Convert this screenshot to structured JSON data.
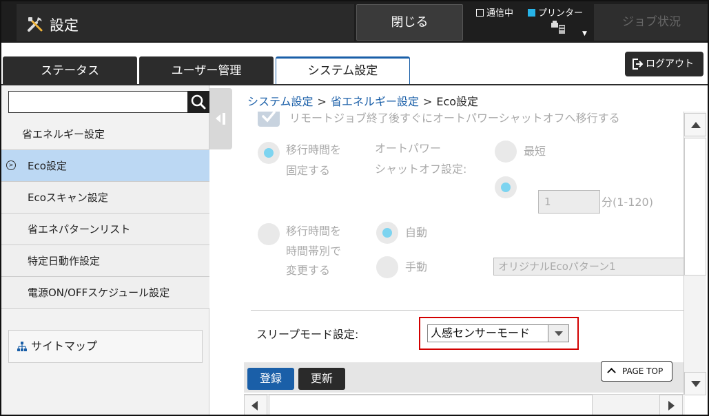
{
  "header": {
    "title": "設定",
    "title_icon": "tools-icon",
    "close_label": "閉じる",
    "indicators": [
      {
        "label": "通信中",
        "state": "off",
        "color": "#ffffff"
      },
      {
        "label": "プリンター",
        "state": "on",
        "color": "#27b4e8"
      }
    ],
    "job_status_label": "ジョブ状況"
  },
  "tabs": [
    {
      "label": "ステータス",
      "active": false
    },
    {
      "label": "ユーザー管理",
      "active": false
    },
    {
      "label": "システム設定",
      "active": true
    }
  ],
  "logout_label": "ログアウト",
  "sidebar": {
    "search_value": "",
    "section_title": "省エネルギー設定",
    "items": [
      {
        "label": "Eco設定",
        "active": true
      },
      {
        "label": "Ecoスキャン設定",
        "active": false
      },
      {
        "label": "省エネパターンリスト",
        "active": false
      },
      {
        "label": "特定日動作設定",
        "active": false
      },
      {
        "label": "電源ON/OFFスケジュール設定",
        "active": false
      }
    ],
    "sitemap_label": "サイトマップ"
  },
  "breadcrumb": {
    "items": [
      "システム設定",
      "省エネルギー設定",
      "Eco設定"
    ],
    "separator": ">"
  },
  "content": {
    "top_checkbox_label": "リモートジョブ終了後すぐにオートパワーシャットオフへ移行する",
    "fixed_time": {
      "label_line1": "移行時間を",
      "label_line2": "固定する",
      "setting_line1": "オートパワー",
      "setting_line2": "シャットオフ設定:",
      "shortest_label": "最短",
      "minutes_value": "1",
      "minutes_unit": "分(1-120)"
    },
    "time_zone": {
      "label_line1": "移行時間を",
      "label_line2": "時間帯別で",
      "label_line3": "変更する",
      "auto_label": "自動",
      "manual_label": "手動",
      "pattern_value": "オリジナルEcoパターン1"
    },
    "sleep": {
      "label": "スリープモード設定:",
      "value": "人感センサーモード"
    }
  },
  "actions": {
    "register_label": "登録",
    "update_label": "更新",
    "page_top_label": "PAGE TOP"
  },
  "colors": {
    "accent": "#1a5fa8",
    "header_bg": "#1e1e1e",
    "active_item_bg": "#bcd8f3",
    "highlight_border": "#d20000"
  }
}
